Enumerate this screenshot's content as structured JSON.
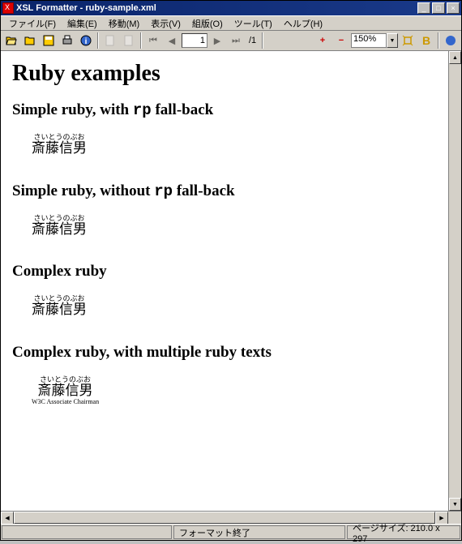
{
  "title": "XSL Formatter - ruby-sample.xml",
  "menu": {
    "file": "ファイル(F)",
    "edit": "編集(E)",
    "move": "移動(M)",
    "view": "表示(V)",
    "format": "組版(O)",
    "tool": "ツール(T)",
    "help": "ヘルプ(H)"
  },
  "toolbar": {
    "page_value": "1",
    "page_total": "/1",
    "zoom_value": "150%"
  },
  "document": {
    "h1": "Ruby examples",
    "h2_a_pre": "Simple ruby, with ",
    "h2_a_code": "rp",
    "h2_a_post": " fall-back",
    "h2_b_pre": "Simple ruby, without ",
    "h2_b_code": "rp",
    "h2_b_post": " fall-back",
    "h2_c": "Complex ruby",
    "h2_d": "Complex ruby, with multiple ruby texts",
    "ruby": {
      "top": "さいとうのぶお",
      "base": "斎藤信男",
      "bottom": "W3C Associate Chairman"
    }
  },
  "status": {
    "left": "",
    "center": "フォーマット終了",
    "right": "ページサイズ: 210.0 x 297"
  }
}
